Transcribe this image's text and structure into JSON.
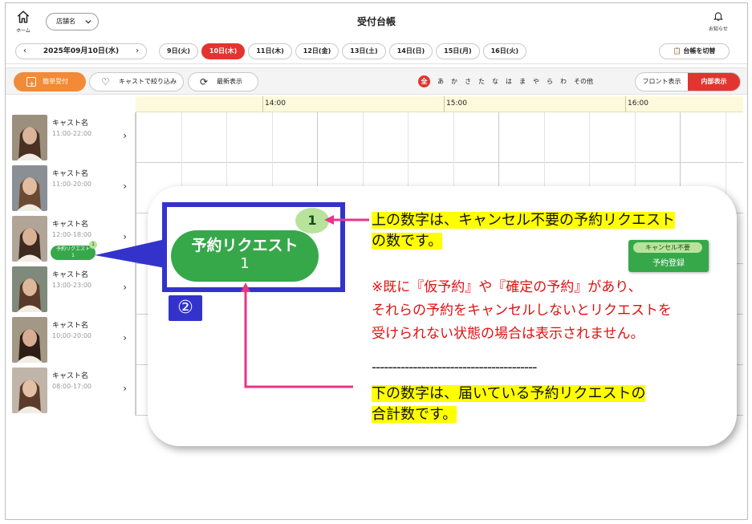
{
  "header": {
    "home_label": "ホーム",
    "store_label": "店舗名",
    "title": "受付台帳",
    "notice_label": "お知らせ"
  },
  "date_row": {
    "current_date": "2025年09月10日(水)",
    "days": [
      "9日(火)",
      "10日(木)",
      "11日(木)",
      "12日(金)",
      "13日(土)",
      "14日(日)",
      "15日(月)",
      "16日(火)"
    ],
    "active_index": 1,
    "switch_label": "台帳を切替"
  },
  "toolbar": {
    "quick_label": "簡単受付",
    "cast_filter_label": "キャストで絞り込み",
    "latest_label": "最新表示",
    "kana": [
      "全",
      "あ",
      "か",
      "さ",
      "た",
      "な",
      "は",
      "ま",
      "や",
      "ら",
      "わ",
      "その他"
    ],
    "view_front": "フロント表示",
    "view_internal": "内部表示"
  },
  "timeline": {
    "hours": [
      "14:00",
      "15:00",
      "16:00"
    ]
  },
  "casts": [
    {
      "name": "キャスト名",
      "hours": "11:00-22:00"
    },
    {
      "name": "キャスト名",
      "hours": "11:00-20:00"
    },
    {
      "name": "キャスト名",
      "hours": "12:00-18:00",
      "request": {
        "label": "予約リクエスト",
        "total": "1",
        "badge": "1"
      }
    },
    {
      "name": "キャスト名",
      "hours": "13:00-23:00"
    },
    {
      "name": "キャスト名",
      "hours": "10:00-20:00"
    },
    {
      "name": "キャスト名",
      "hours": "08:00-17:00"
    }
  ],
  "callout": {
    "step_number": "②",
    "big_request_label": "予約リクエスト",
    "big_request_total": "1",
    "big_badge": "1",
    "text1_line1": "上の数字は、キャンセル不要の予約リクエスト",
    "text1_line2": "の数です。",
    "note_line1": "※既に『仮予約』や『確定の予約』があり、",
    "note_line2": "それらの予約をキャンセルしないとリクエストを",
    "note_line3": "受けられない状態の場合は表示されません。",
    "dashes": "----------------------------------------",
    "text3_line1": "下の数字は、届いている予約リクエストの",
    "text3_line2": "合計数です。",
    "cancel_tag": "キャンセル不要",
    "cancel_button_label": "予約登録"
  },
  "colors": {
    "accent_red": "#e3342f",
    "orange": "#f28a37",
    "green": "#36a84a",
    "light_green": "#b7e39b",
    "callout_blue": "#3333cc",
    "highlight": "#ffff00",
    "pointer_pink": "#e8358a"
  }
}
